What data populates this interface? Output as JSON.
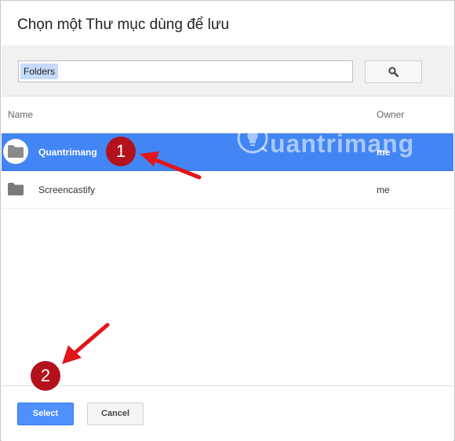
{
  "dialog": {
    "title": "Chọn một Thư mục dùng để lưu"
  },
  "search": {
    "chip_label": "Folders",
    "button_icon": "search-icon"
  },
  "columns": {
    "name": "Name",
    "owner": "Owner"
  },
  "folders": [
    {
      "name": "Quantrimang",
      "owner": "me",
      "selected": true
    },
    {
      "name": "Screencastify",
      "owner": "me",
      "selected": false
    }
  ],
  "footer": {
    "select_label": "Select",
    "cancel_label": "Cancel"
  },
  "annotations": {
    "step1": "1",
    "step2": "2",
    "badge_color": "#b3121c",
    "arrow_color": "#e0161b"
  },
  "watermark": {
    "text": "uantrimang"
  },
  "colors": {
    "selected_row": "#4285f4",
    "select_button": "#4d90fe"
  }
}
